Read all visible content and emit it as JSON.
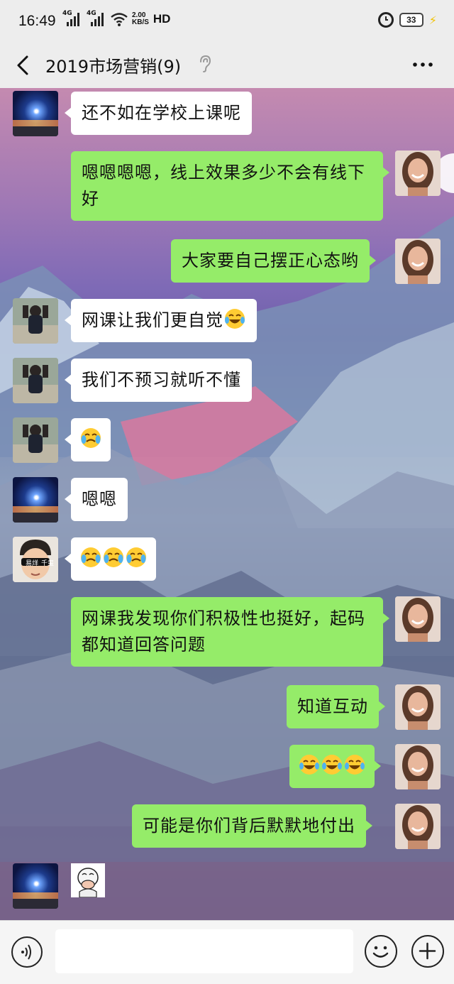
{
  "status_bar": {
    "time": "16:49",
    "network_1": "4G",
    "network_2": "4G",
    "speed_value": "2.00",
    "speed_unit": "KB/S",
    "hd": "HD",
    "battery": "33"
  },
  "header": {
    "title": "2019市场营销(9)"
  },
  "messages": [
    {
      "side": "in",
      "avatar": "night-sky",
      "text": "还不如在学校上课呢"
    },
    {
      "side": "out",
      "avatar": "girl-smiling",
      "text": "嗯嗯嗯嗯，线上效果多少不会有线下好"
    },
    {
      "side": "out",
      "avatar": "girl-smiling",
      "text": "大家要自己摆正心态哟"
    },
    {
      "side": "in",
      "avatar": "kid-photo",
      "text": "网课让我们更自觉",
      "emoji": "laugh-cry-emoji"
    },
    {
      "side": "in",
      "avatar": "kid-photo",
      "text": "我们不预习就听不懂"
    },
    {
      "side": "in",
      "avatar": "kid-photo",
      "emoji": "cry-emoji"
    },
    {
      "side": "in",
      "avatar": "night-sky",
      "text": "嗯嗯"
    },
    {
      "side": "in",
      "avatar": "boy-sticker",
      "emoji": "cry-emoji x3",
      "avatar_caption_left": "易烊",
      "avatar_caption_right": "千玺"
    },
    {
      "side": "out",
      "avatar": "girl-smiling",
      "text": "网课我发现你们积极性也挺好，起码都知道回答问题"
    },
    {
      "side": "out",
      "avatar": "girl-smiling",
      "text": "知道互动"
    },
    {
      "side": "out",
      "avatar": "girl-smiling",
      "emoji": "laugh-cry-emoji x3"
    },
    {
      "side": "out",
      "avatar": "girl-smiling",
      "text": "可能是你们背后默默地付出"
    },
    {
      "side": "in",
      "avatar": "night-sky",
      "sticker": "covering-mouth-sticker"
    }
  ],
  "colors": {
    "outgoing_bubble": "#95ec69",
    "incoming_bubble": "#ffffff",
    "bar_background": "#ededed"
  },
  "input": {
    "placeholder": ""
  }
}
